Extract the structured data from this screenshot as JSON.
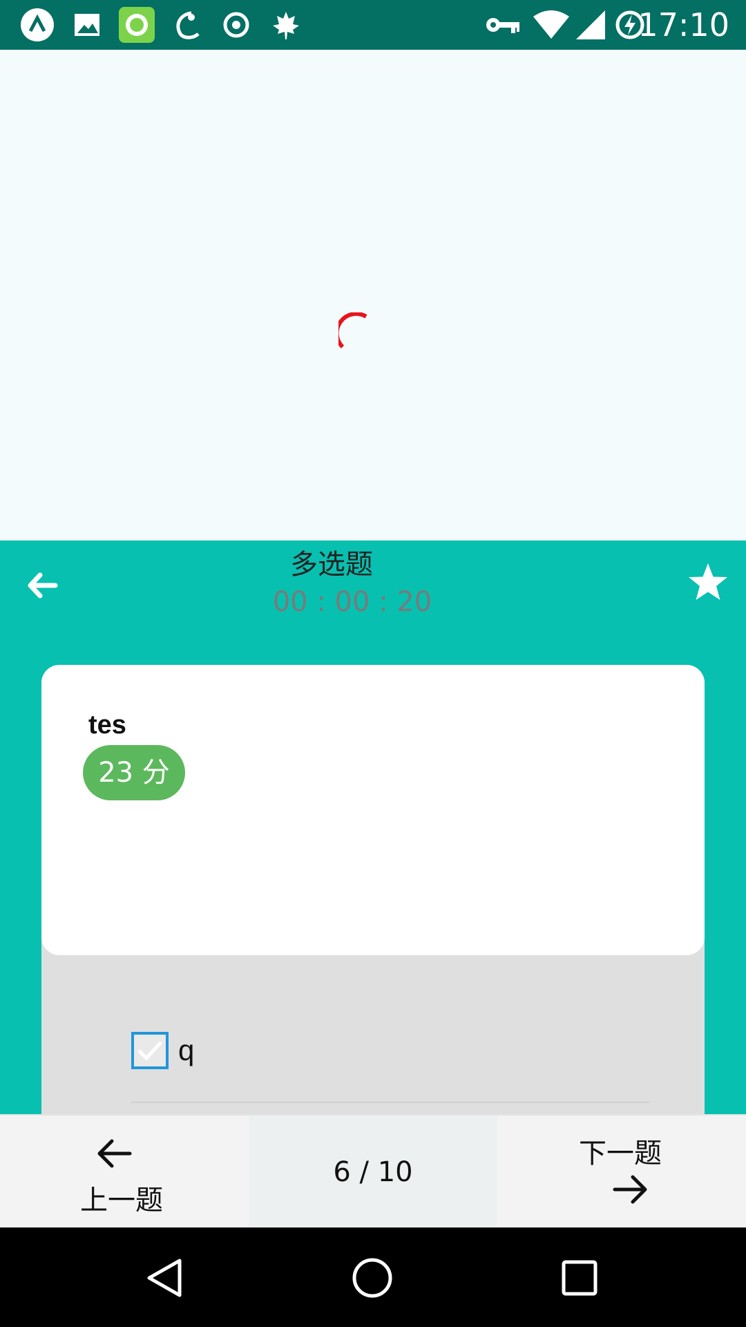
{
  "status_bar": {
    "time": "17:10",
    "left_icons": [
      "app-a-icon",
      "image-icon",
      "green-app-icon",
      "cat-app-icon",
      "target-icon",
      "maple-leaf-icon"
    ],
    "right_icons": [
      "vpn-key-icon",
      "wifi-icon",
      "signal-icon",
      "battery-charging-icon"
    ]
  },
  "loading": {
    "spinner_color": "#e8141c"
  },
  "header": {
    "title": "多选题",
    "timer": "00 : 00 : 20",
    "background_color": "#07c0b0"
  },
  "question": {
    "text": "tes",
    "score": "23 分",
    "score_color": "#5cb85c"
  },
  "options": [
    {
      "label": "q",
      "checked": true
    }
  ],
  "bottom_nav": {
    "prev_label": "上一题",
    "next_label": "下一题",
    "current": "6",
    "separator": "/",
    "total": "10"
  }
}
